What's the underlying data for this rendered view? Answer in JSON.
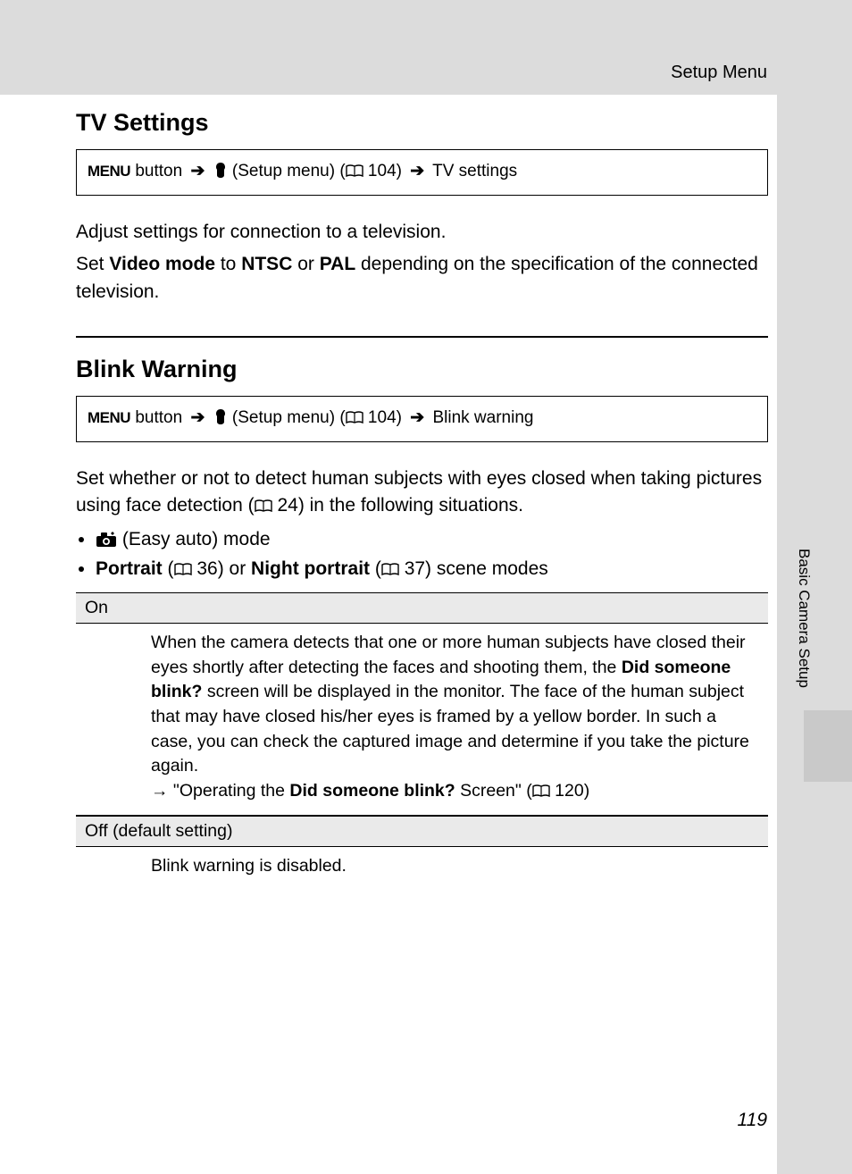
{
  "header": {
    "section": "Setup Menu"
  },
  "side": {
    "label": "Basic Camera Setup"
  },
  "tv": {
    "title": "TV Settings",
    "nav": {
      "menu": "MENU",
      "button": " button ",
      "setup": " (Setup menu) (",
      "pageref": " 104) ",
      "dest": " TV settings"
    },
    "p1": "Adjust settings for connection to a television.",
    "p2a": "Set ",
    "p2b": "Video mode",
    "p2c": " to ",
    "p2d": "NTSC",
    "p2e": " or ",
    "p2f": "PAL",
    "p2g": " depending on the specification of the connected television."
  },
  "bw": {
    "title": "Blink Warning",
    "nav": {
      "menu": "MENU",
      "button": " button ",
      "setup": " (Setup menu) (",
      "pageref": " 104) ",
      "dest": " Blink warning"
    },
    "p1a": "Set whether or not to detect human subjects with eyes closed when taking pictures using face detection (",
    "p1b": " 24) in the following situations.",
    "li1": " (Easy auto) mode",
    "li2a": "Portrait",
    "li2b": " (",
    "li2c": " 36) or ",
    "li2d": "Night portrait",
    "li2e": " (",
    "li2f": " 37) scene modes",
    "row1": {
      "head": "On",
      "b1": "When the camera detects that one or more human subjects have closed their eyes shortly after detecting the faces and shooting them, the ",
      "b2": "Did someone blink?",
      "b3": " screen will be displayed in the monitor. The face of the human subject that may have closed his/her eyes is framed by a yellow border. In such a case, you can check the captured image and determine if you take the picture again.",
      "b4": "→ \"Operating the ",
      "b5": "Did someone blink?",
      "b6": " Screen\" (",
      "b7": " 120)"
    },
    "row2": {
      "head": "Off (default setting)",
      "body": "Blink warning is disabled."
    }
  },
  "pagenum": "119"
}
